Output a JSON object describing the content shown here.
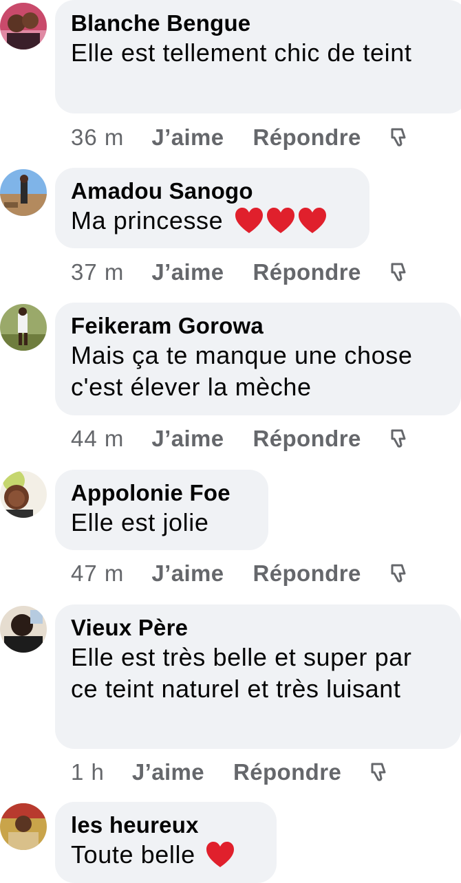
{
  "comments": [
    {
      "author": "Blanche Bengue",
      "text": "Elle est tellement chic de teint",
      "hearts": 0,
      "time": "36 m",
      "like_label": "J’aime",
      "reply_label": "Répondre",
      "avatar_icon": "avatar-photo"
    },
    {
      "author": "Amadou Sanogo",
      "text": "Ma princesse",
      "hearts": 3,
      "time": "37 m",
      "like_label": "J’aime",
      "reply_label": "Répondre",
      "avatar_icon": "avatar-photo"
    },
    {
      "author": "Feikeram Gorowa",
      "text": "Mais ça te manque une chose c'est élever la mèche",
      "hearts": 0,
      "time": "44 m",
      "like_label": "J’aime",
      "reply_label": "Répondre",
      "avatar_icon": "avatar-photo"
    },
    {
      "author": "Appolonie Foe",
      "text": "Elle est jolie",
      "hearts": 0,
      "time": "47 m",
      "like_label": "J’aime",
      "reply_label": "Répondre",
      "avatar_icon": "avatar-photo"
    },
    {
      "author": "Vieux Père",
      "text": "Elle est très belle et super par ce teint naturel et très luisant",
      "hearts": 0,
      "time": "1 h",
      "like_label": "J’aime",
      "reply_label": "Répondre",
      "avatar_icon": "avatar-photo"
    },
    {
      "author": "les heureux",
      "text": "Toute belle",
      "hearts": 1,
      "time": "",
      "like_label": "",
      "reply_label": "",
      "avatar_icon": "avatar-photo"
    }
  ],
  "colors": {
    "bubble": "#f0f2f5",
    "meta_text": "#65676b",
    "heart": "#e0202c"
  },
  "icons": {
    "heart": "red-heart-emoji",
    "dislike": "thumbs-down-icon"
  }
}
